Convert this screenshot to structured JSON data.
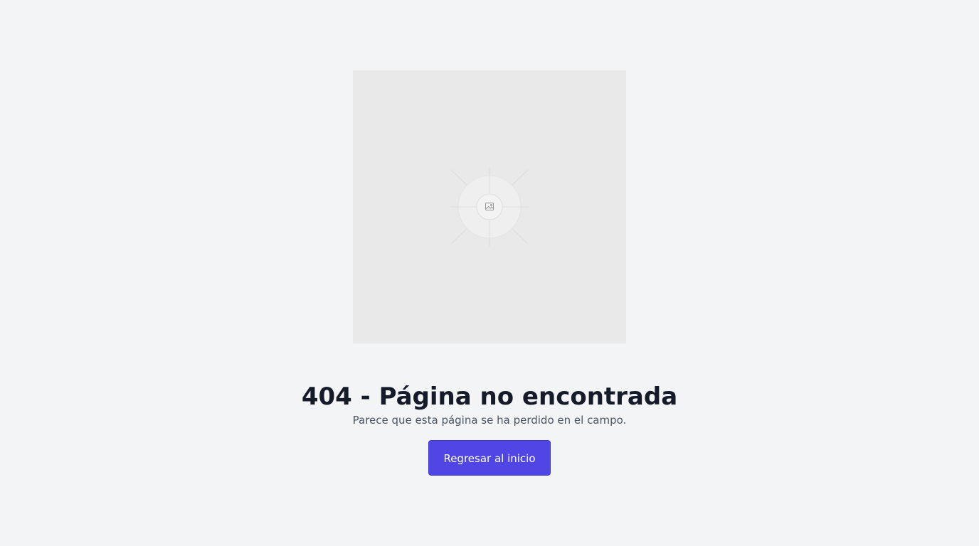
{
  "image_placeholder": {
    "icon": "image-icon"
  },
  "error": {
    "title": "404 - Página no encontrada",
    "message": "Parece que esta página se ha perdido en el campo."
  },
  "actions": {
    "home_label": "Regresar al inicio"
  },
  "colors": {
    "background": "#f2f4f6",
    "placeholder": "#e9e9e9",
    "title": "#151b29",
    "message": "#4b5563",
    "button": "#4f46e5",
    "button_text": "#ffffff"
  }
}
